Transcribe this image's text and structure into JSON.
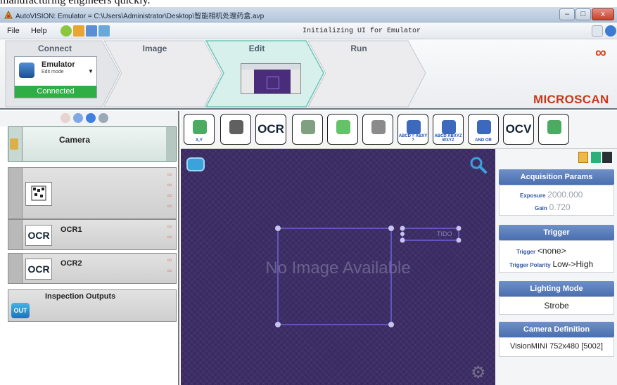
{
  "caption": {
    "text": "manufacturing engineers quickly."
  },
  "window": {
    "title": "AutoVISION: Emulator = C:\\Users\\Administrator\\Desktop\\智能相机处理药盒.avp",
    "minimize": "–",
    "maximize": "□",
    "close": "x"
  },
  "menu": {
    "file": "File",
    "help": "Help",
    "status": "Initializing UI for Emulator"
  },
  "workflow": {
    "steps": [
      "Connect",
      "Image",
      "Edit",
      "Run"
    ],
    "device": {
      "name": "Emulator",
      "mode": "Edit mode",
      "status": "Connected"
    },
    "brand": "MICROSCAN"
  },
  "tools": {
    "camera": "Camera",
    "items": [
      {
        "label": "",
        "badge": ""
      },
      {
        "label": "OCR1",
        "badge": "OCR"
      },
      {
        "label": "OCR2",
        "badge": "OCR"
      }
    ],
    "outputs": {
      "label": "Inspection Outputs",
      "badge": "OUT"
    }
  },
  "toolbar": {
    "buttons": [
      {
        "name": "locate-tool-button",
        "text": "",
        "sub": "X,Y"
      },
      {
        "name": "datamatrix-tool-button",
        "text": "",
        "sub": ""
      },
      {
        "name": "ocr-tool-button",
        "text": "OCR",
        "sub": ""
      },
      {
        "name": "blob-tool-button",
        "text": "",
        "sub": ""
      },
      {
        "name": "presence-tool-button",
        "text": "",
        "sub": ""
      },
      {
        "name": "measure-tool-button",
        "text": "",
        "sub": ""
      },
      {
        "name": "text-match-tool-button",
        "text": "",
        "sub": "ABCD = ABXY ?"
      },
      {
        "name": "text-verify-tool-button",
        "text": "",
        "sub": "ABCD ABXYZ WXYZ"
      },
      {
        "name": "logic-tool-button",
        "text": "",
        "sub": "AND OR"
      },
      {
        "name": "ocv-tool-button",
        "text": "OCV",
        "sub": ""
      },
      {
        "name": "verify-tool-button",
        "text": "",
        "sub": ""
      }
    ]
  },
  "viewport": {
    "no_image": "No Image Available",
    "roi_text": "TIDO"
  },
  "properties": {
    "acquisition": {
      "title": "Acquisition Params",
      "exposure_label": "Exposure",
      "exposure_value": "2000.000",
      "gain_label": "Gain",
      "gain_value": "0.720"
    },
    "trigger": {
      "title": "Trigger",
      "trigger_label": "Trigger",
      "trigger_value": "<none>",
      "polarity_label": "Trigger Polarity",
      "polarity_value": "Low->High"
    },
    "lighting": {
      "title": "Lighting Mode",
      "value": "Strobe"
    },
    "camera_def": {
      "title": "Camera Definition",
      "value": "VisionMINI 752x480  [5002]"
    }
  },
  "colors": {
    "accent": "#4a6fb0",
    "connected": "#2fae46",
    "brand": "#c9381a",
    "canvas": "#3a2b63"
  }
}
